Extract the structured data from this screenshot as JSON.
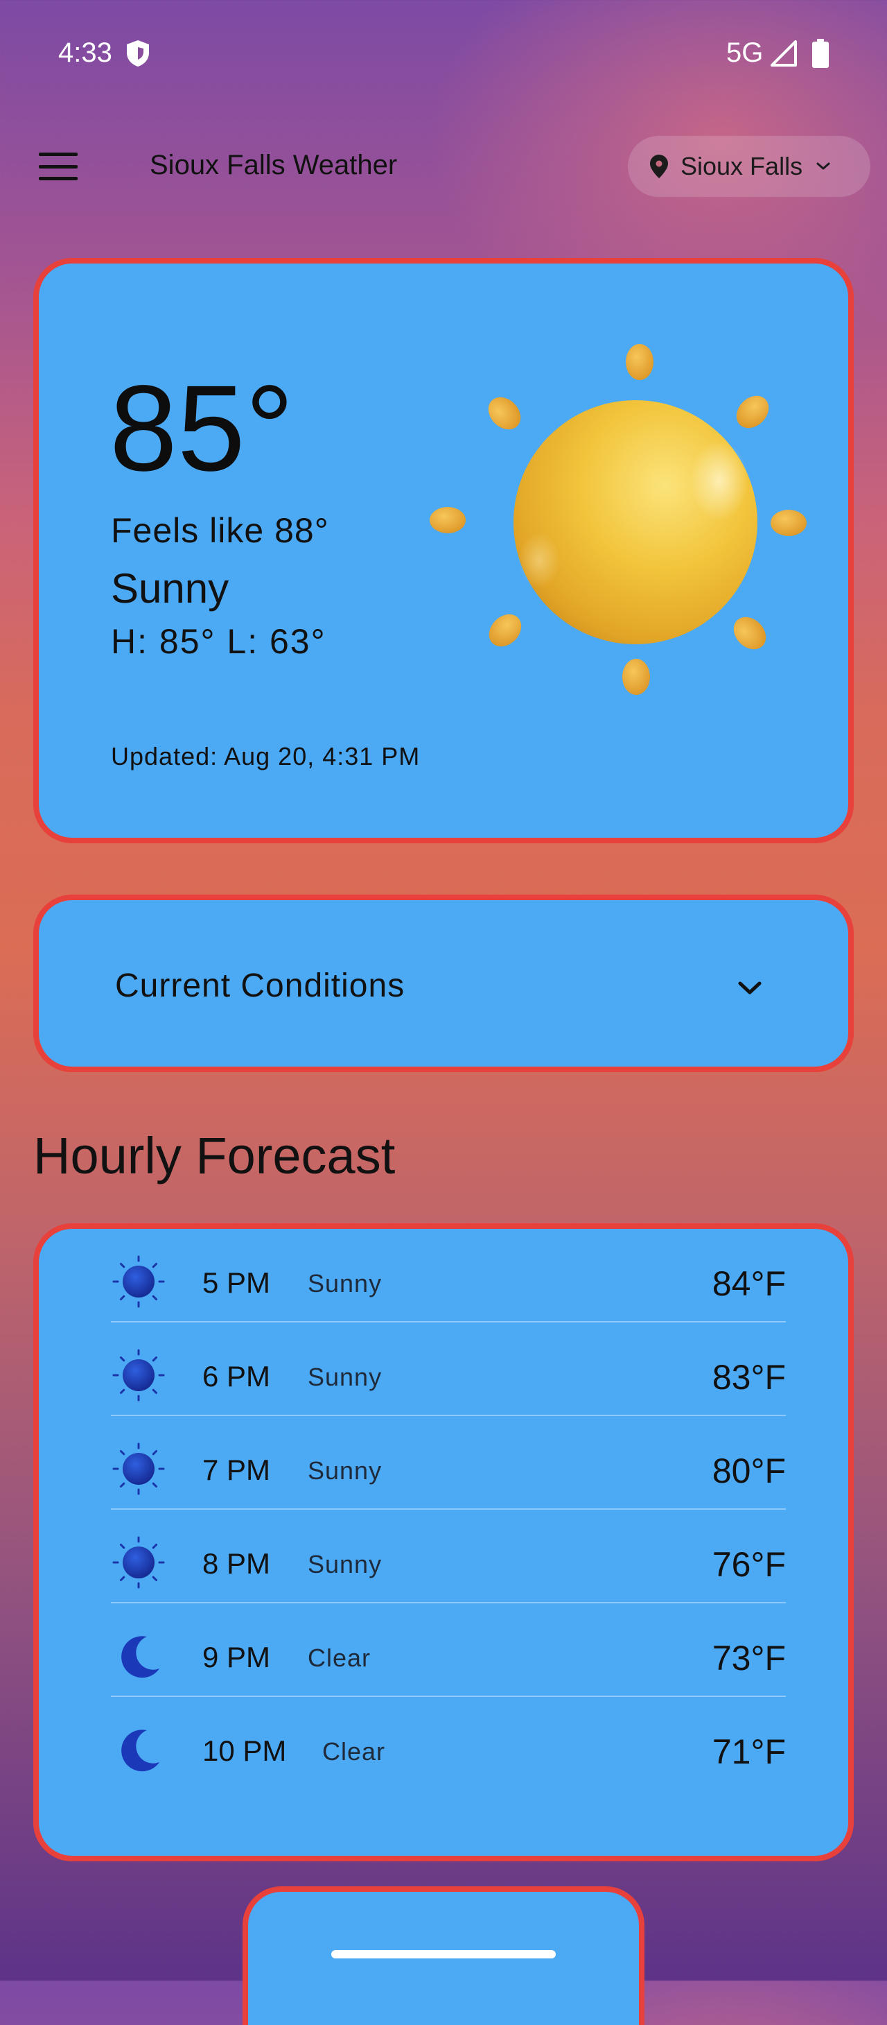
{
  "status_bar": {
    "time": "4:33",
    "network": "5G",
    "icons": [
      "shield-icon",
      "signal-icon",
      "battery-icon"
    ]
  },
  "app_bar": {
    "title": "Sioux Falls Weather",
    "location": "Sioux Falls",
    "menu_icon": "hamburger-menu-icon",
    "location_icon": "map-pin-icon"
  },
  "current": {
    "temperature": "85°",
    "feels_like": "Feels like 88°",
    "condition": "Sunny",
    "hi_lo": "H: 85°  L: 63°",
    "updated": "Updated: Aug 20, 4:31 PM",
    "illustration": "sun-icon"
  },
  "conditions_panel": {
    "title": "Current Conditions",
    "expanded": false
  },
  "hourly": {
    "heading": "Hourly Forecast",
    "rows": [
      {
        "time": "5 PM",
        "condition": "Sunny",
        "temp": "84°F",
        "icon": "sun"
      },
      {
        "time": "6 PM",
        "condition": "Sunny",
        "temp": "83°F",
        "icon": "sun"
      },
      {
        "time": "7 PM",
        "condition": "Sunny",
        "temp": "80°F",
        "icon": "sun"
      },
      {
        "time": "8 PM",
        "condition": "Sunny",
        "temp": "76°F",
        "icon": "sun"
      },
      {
        "time": "9 PM",
        "condition": "Clear",
        "temp": "73°F",
        "icon": "moon"
      },
      {
        "time": "10 PM",
        "condition": "Clear",
        "temp": "71°F",
        "icon": "moon"
      }
    ]
  },
  "colors": {
    "card_fill": "#4ca9f4",
    "card_border": "#e8403a",
    "icon_blue": "#1f3fb8"
  }
}
